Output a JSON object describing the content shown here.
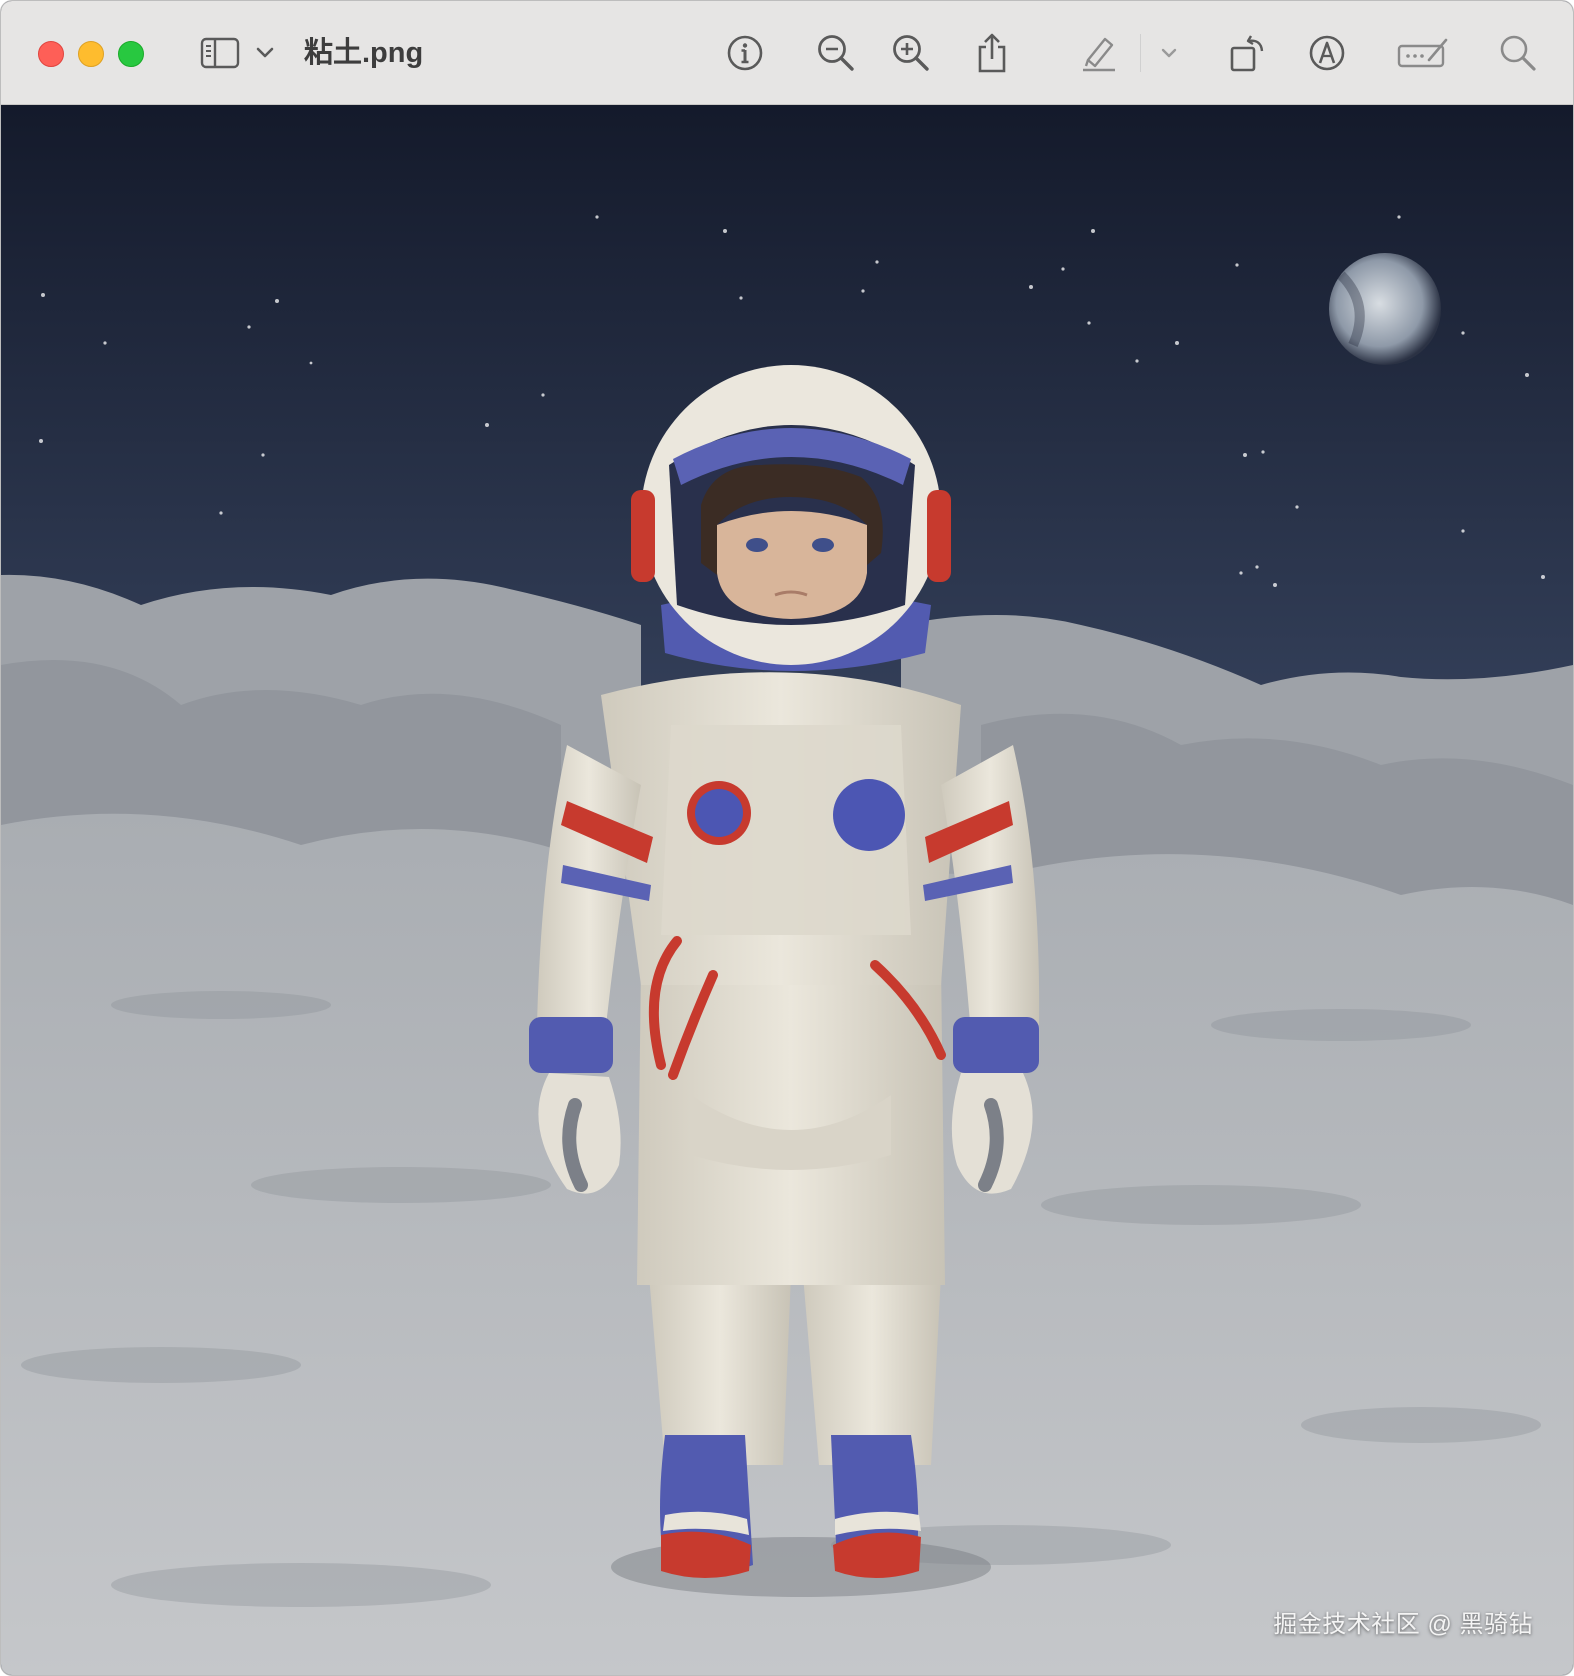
{
  "window": {
    "title": "粘土.png"
  },
  "toolbar": {
    "buttons": [
      {
        "name": "sidebar-toggle",
        "icon": "sidebar-icon"
      },
      {
        "name": "sidebar-menu",
        "icon": "chevron-down-icon"
      },
      {
        "name": "info",
        "icon": "info-icon"
      },
      {
        "name": "zoom-out",
        "icon": "zoom-out-icon"
      },
      {
        "name": "zoom-in",
        "icon": "zoom-in-icon"
      },
      {
        "name": "share",
        "icon": "share-icon"
      },
      {
        "name": "highlight",
        "icon": "highlighter-icon"
      },
      {
        "name": "highlight-menu",
        "icon": "chevron-down-icon"
      },
      {
        "name": "rotate",
        "icon": "rotate-icon"
      },
      {
        "name": "markup",
        "icon": "markup-icon"
      },
      {
        "name": "form-fill",
        "icon": "form-icon"
      },
      {
        "name": "search",
        "icon": "search-icon"
      }
    ]
  },
  "image": {
    "watermark": "掘金技术社区 @ 黑骑钻"
  },
  "colors": {
    "titlebar_bg": "#e6e5e4",
    "close": "#fe5f57",
    "minimize": "#febc2e",
    "zoom": "#28c840",
    "icon": "#5a5a5a",
    "sky": "#1b2236",
    "moon_ground": "#b9bcbf",
    "suit": "#e4e0d5",
    "accent_blue": "#4c56b3",
    "accent_red": "#cc3a30"
  }
}
